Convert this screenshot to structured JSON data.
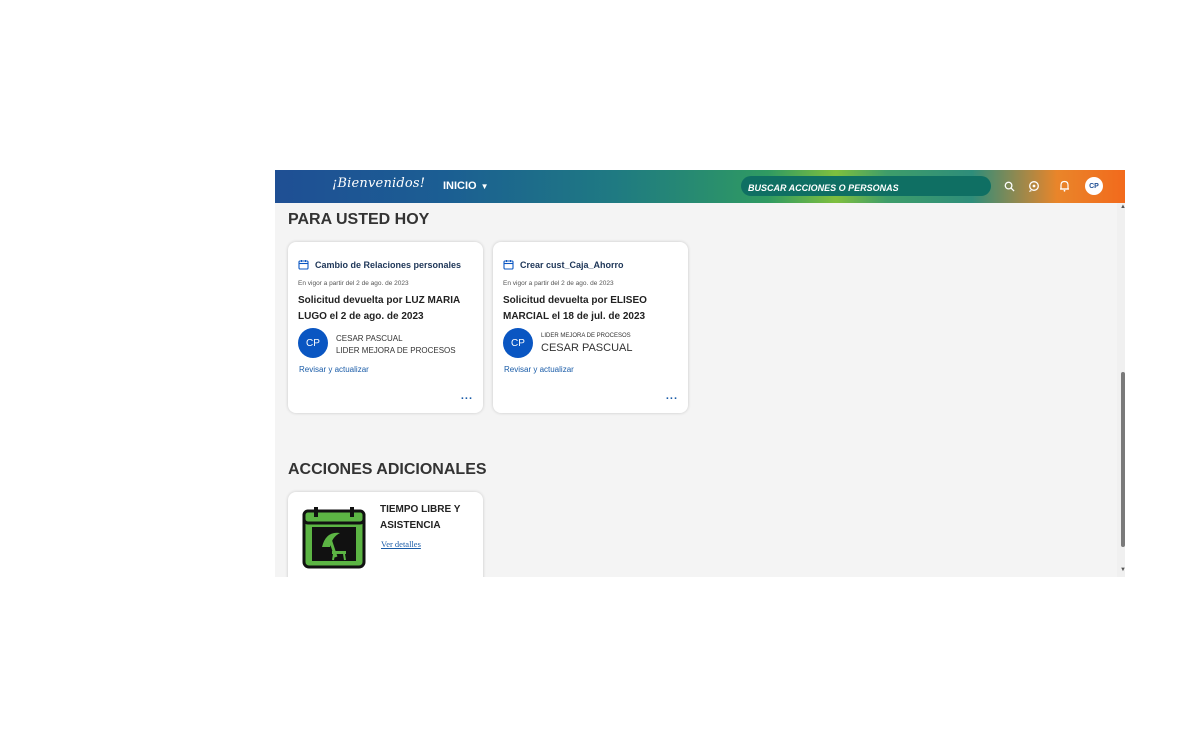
{
  "header": {
    "brand": "¡Bienvenidos!",
    "nav_label": "INICIO",
    "search_placeholder": "BUSCAR ACCIONES O PERSONAS",
    "avatar_initials": "CP"
  },
  "sections": {
    "today_title": "PARA USTED HOY",
    "actions_title": "ACCIONES ADICIONALES"
  },
  "cards": [
    {
      "type": "Cambio de Relaciones personales",
      "effective": "En vigor a partir del 2 de ago. de 2023",
      "title": "Solicitud devuelta por LUZ MARIA LUGO el 2 de ago. de 2023",
      "initials": "CP",
      "person_name": "CESAR PASCUAL",
      "person_role": "LIDER MEJORA DE PROCESOS",
      "link": "Revisar y actualizar",
      "more": "..."
    },
    {
      "type": "Crear cust_Caja_Ahorro",
      "effective": "En vigor a partir del 2 de ago. de 2023",
      "title": "Solicitud devuelta por ELISEO MARCIAL el 18 de jul. de 2023",
      "initials": "CP",
      "person_role": "LIDER MEJORA DE PROCESOS",
      "person_name": "CESAR PASCUAL",
      "link": "Revisar y actualizar",
      "more": "..."
    }
  ],
  "action": {
    "title": "TIEMPO LIBRE Y ASISTENCIA",
    "link": "Ver detalles"
  },
  "colors": {
    "accent_blue": "#0a56c2",
    "link_blue": "#1a5ca8",
    "calendar_green": "#5cb544"
  },
  "icons": [
    "search-icon",
    "feedback-icon",
    "bell-icon",
    "calendar-icon",
    "chevron-down-icon"
  ]
}
